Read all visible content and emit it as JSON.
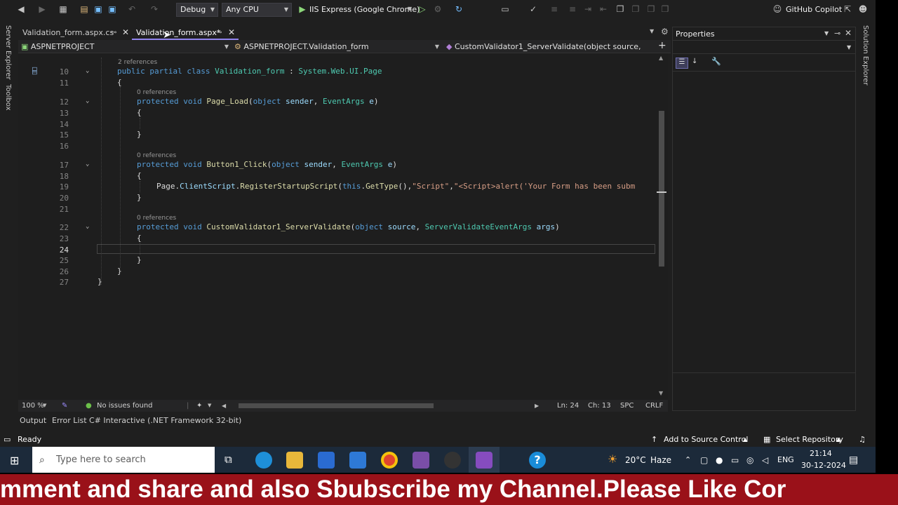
{
  "toolbar": {
    "configuration": "Debug",
    "platform": "Any CPU",
    "run_target": "IIS Express (Google Chrome)",
    "copilot_label": "GitHub Copilot"
  },
  "side_tabs": {
    "server_explorer": "Server Explorer",
    "toolbox": "Toolbox",
    "solution_explorer": "Solution Explorer"
  },
  "tabs": [
    {
      "label": "Validation_form.aspx.cs"
    },
    {
      "label": "Validation_form.aspx*"
    }
  ],
  "nav": {
    "project": "ASPNETPROJECT",
    "class": "ASPNETPROJECT.Validation_form",
    "member": "CustomValidator1_ServerValidate(object source, ServerV"
  },
  "editor": {
    "lines": [
      {
        "n": "10",
        "ref": "2 references"
      },
      {
        "n": "11"
      },
      {
        "n": "12",
        "ref": "0 references"
      },
      {
        "n": "13"
      },
      {
        "n": "14"
      },
      {
        "n": "15"
      },
      {
        "n": "16"
      },
      {
        "n": "17",
        "ref": "0 references"
      },
      {
        "n": "18"
      },
      {
        "n": "19"
      },
      {
        "n": "20"
      },
      {
        "n": "21"
      },
      {
        "n": "22",
        "ref": "0 references"
      },
      {
        "n": "23"
      },
      {
        "n": "24"
      },
      {
        "n": "25"
      },
      {
        "n": "26"
      },
      {
        "n": "27"
      }
    ],
    "code": {
      "l10_kw1": "public",
      "l10_kw2": "partial",
      "l10_kw3": "class",
      "l10_name": "Validation_form",
      "l10_colon": " : ",
      "l10_base": "System.Web.UI.Page",
      "brace_open": "{",
      "brace_close": "}",
      "kw_protected": "protected",
      "kw_void": "void",
      "kw_object": "object",
      "kw_this": "this",
      "l12_fn": "Page_Load",
      "l12_p1": "sender",
      "l12_t2": "EventArgs",
      "l12_p2": "e",
      "l17_fn": "Button1_Click",
      "l19_obj": "Page",
      "l19_prop": "ClientScript",
      "l19_fn": "RegisterStartupScript",
      "l19_fn2": "GetType",
      "l19_s1": "\"Script\"",
      "l19_s2": "\"<Script>alert('Your Form has been subm",
      "l22_fn": "CustomValidator1_ServerValidate",
      "l22_p1": "source",
      "l22_t2": "ServerValidateEventArgs",
      "l22_p2": "args"
    }
  },
  "editor_status": {
    "zoom": "100 %",
    "issues": "No issues found",
    "line": "Ln: 24",
    "col": "Ch: 13",
    "whitespace": "SPC",
    "eol": "CRLF"
  },
  "properties": {
    "title": "Properties"
  },
  "bottom_tabs": [
    "Output",
    "Error List",
    "C# Interactive (.NET Framework 32-bit)"
  ],
  "status": {
    "state": "Ready",
    "source_control": "Add to Source Control",
    "repository": "Select Repository"
  },
  "taskbar": {
    "search_placeholder": "Type here to search",
    "weather_temp": "20°C",
    "weather_desc": "Haze",
    "lang": "ENG",
    "time": "21:14",
    "date": "30-12-2024"
  },
  "marquee": "mment and share and also Sbubscribe my Channel.Please Like Cor"
}
